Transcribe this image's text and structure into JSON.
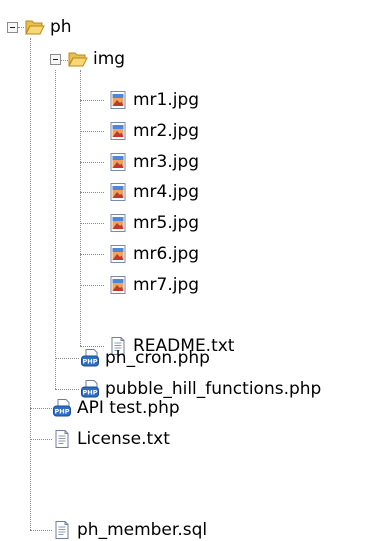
{
  "tree": {
    "root": {
      "label": "ph",
      "icon": "folder-open-icon",
      "children": {
        "img": {
          "label": "img",
          "icon": "folder-open-icon",
          "files": [
            {
              "label": "mr1.jpg",
              "icon": "image-file-icon"
            },
            {
              "label": "mr2.jpg",
              "icon": "image-file-icon"
            },
            {
              "label": "mr3.jpg",
              "icon": "image-file-icon"
            },
            {
              "label": "mr4.jpg",
              "icon": "image-file-icon"
            },
            {
              "label": "mr5.jpg",
              "icon": "image-file-icon"
            },
            {
              "label": "mr6.jpg",
              "icon": "image-file-icon"
            },
            {
              "label": "mr7.jpg",
              "icon": "image-file-icon"
            },
            {
              "label": "README.txt",
              "icon": "text-file-icon"
            }
          ]
        },
        "ph_cron": {
          "label": "ph_cron.php",
          "icon": "php-file-icon"
        },
        "pubble": {
          "label": "pubble_hill_functions.php",
          "icon": "php-file-icon"
        }
      }
    },
    "top_files": [
      {
        "label": "API test.php",
        "icon": "php-file-icon"
      },
      {
        "label": "License.txt",
        "icon": "text-file-icon"
      },
      {
        "label": "ph_member.sql",
        "icon": "text-file-icon"
      }
    ]
  }
}
